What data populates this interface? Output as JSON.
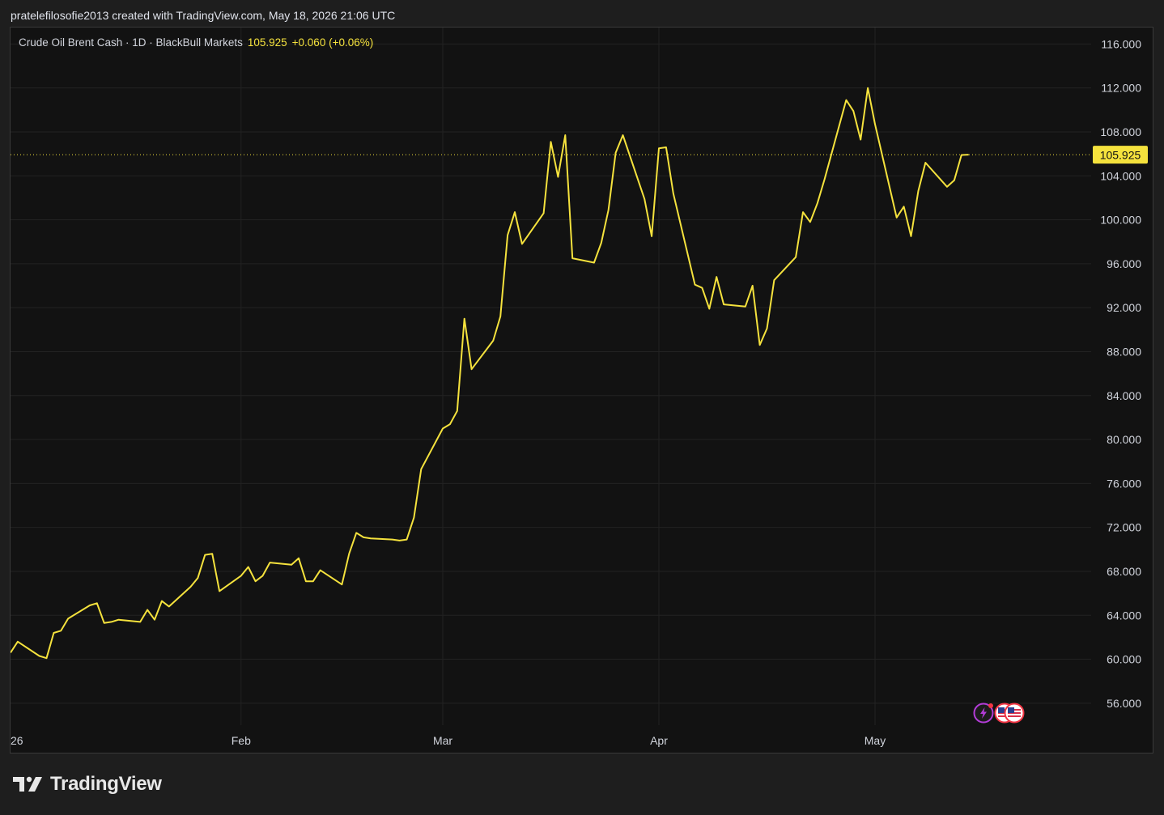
{
  "header": {
    "attribution": "pratelefilosofie2013 created with TradingView.com, May 18, 2026 21:06 UTC"
  },
  "legend": {
    "symbol": "Crude Oil Brent Cash · 1D · BlackBull Markets",
    "last_price": "105.925",
    "change": "+0.060 (+0.06%)"
  },
  "footer": {
    "brand": "TradingView"
  },
  "colors": {
    "line": "#f5e23d",
    "background": "#121212",
    "grid": "#222222",
    "axis_text": "#d1d4dc",
    "price_tag_bg": "#f5e23d",
    "price_tag_text": "#121212"
  },
  "chart_data": {
    "type": "line",
    "title": "",
    "xlabel": "",
    "ylabel": "",
    "ylim": [
      54.0,
      117.5
    ],
    "yticks": [
      56,
      60,
      64,
      68,
      72,
      76,
      80,
      84,
      88,
      92,
      96,
      100,
      104,
      108,
      112,
      116
    ],
    "ytick_labels": [
      "56.000",
      "60.000",
      "64.000",
      "68.000",
      "72.000",
      "76.000",
      "80.000",
      "84.000",
      "88.000",
      "92.000",
      "96.000",
      "100.000",
      "104.000",
      "108.000",
      "112.000",
      "116.000"
    ],
    "xlim": [
      "2026-01-01",
      "2026-05-31"
    ],
    "xticks": [
      {
        "label": "26",
        "date": "2026-01-01"
      },
      {
        "label": "Feb",
        "date": "2026-02-02"
      },
      {
        "label": "Mar",
        "date": "2026-03-02"
      },
      {
        "label": "Apr",
        "date": "2026-04-01"
      },
      {
        "label": "May",
        "date": "2026-05-01"
      }
    ],
    "grid": true,
    "last_value": 105.925,
    "series": [
      {
        "points": [
          [
            "2026-01-01",
            60.6
          ],
          [
            "2026-01-02",
            61.6
          ],
          [
            "2026-01-05",
            60.3
          ],
          [
            "2026-01-06",
            60.1
          ],
          [
            "2026-01-07",
            62.4
          ],
          [
            "2026-01-08",
            62.6
          ],
          [
            "2026-01-09",
            63.7
          ],
          [
            "2026-01-12",
            64.9
          ],
          [
            "2026-01-13",
            65.1
          ],
          [
            "2026-01-14",
            63.3
          ],
          [
            "2026-01-15",
            63.4
          ],
          [
            "2026-01-16",
            63.6
          ],
          [
            "2026-01-19",
            63.4
          ],
          [
            "2026-01-20",
            64.5
          ],
          [
            "2026-01-21",
            63.6
          ],
          [
            "2026-01-22",
            65.3
          ],
          [
            "2026-01-23",
            64.8
          ],
          [
            "2026-01-26",
            66.6
          ],
          [
            "2026-01-27",
            67.4
          ],
          [
            "2026-01-28",
            69.5
          ],
          [
            "2026-01-29",
            69.6
          ],
          [
            "2026-01-30",
            66.2
          ],
          [
            "2026-02-02",
            67.6
          ],
          [
            "2026-02-03",
            68.4
          ],
          [
            "2026-02-04",
            67.1
          ],
          [
            "2026-02-05",
            67.6
          ],
          [
            "2026-02-06",
            68.8
          ],
          [
            "2026-02-09",
            68.6
          ],
          [
            "2026-02-10",
            69.2
          ],
          [
            "2026-02-11",
            67.1
          ],
          [
            "2026-02-12",
            67.1
          ],
          [
            "2026-02-13",
            68.1
          ],
          [
            "2026-02-16",
            66.8
          ],
          [
            "2026-02-17",
            69.6
          ],
          [
            "2026-02-18",
            71.5
          ],
          [
            "2026-02-19",
            71.1
          ],
          [
            "2026-02-20",
            71.0
          ],
          [
            "2026-02-23",
            70.9
          ],
          [
            "2026-02-24",
            70.8
          ],
          [
            "2026-02-25",
            70.9
          ],
          [
            "2026-02-26",
            72.9
          ],
          [
            "2026-02-27",
            77.3
          ],
          [
            "2026-03-02",
            81.0
          ],
          [
            "2026-03-03",
            81.4
          ],
          [
            "2026-03-04",
            82.6
          ],
          [
            "2026-03-05",
            91.0
          ],
          [
            "2026-03-06",
            86.4
          ],
          [
            "2026-03-09",
            89.0
          ],
          [
            "2026-03-10",
            91.2
          ],
          [
            "2026-03-11",
            98.6
          ],
          [
            "2026-03-12",
            100.7
          ],
          [
            "2026-03-13",
            97.8
          ],
          [
            "2026-03-16",
            100.6
          ],
          [
            "2026-03-17",
            107.1
          ],
          [
            "2026-03-18",
            103.9
          ],
          [
            "2026-03-19",
            107.7
          ],
          [
            "2026-03-20",
            96.5
          ],
          [
            "2026-03-23",
            96.1
          ],
          [
            "2026-03-24",
            97.9
          ],
          [
            "2026-03-25",
            100.9
          ],
          [
            "2026-03-26",
            106.1
          ],
          [
            "2026-03-27",
            107.7
          ],
          [
            "2026-03-30",
            101.9
          ],
          [
            "2026-03-31",
            98.5
          ],
          [
            "2026-04-01",
            106.5
          ],
          [
            "2026-04-02",
            106.6
          ],
          [
            "2026-04-03",
            102.4
          ],
          [
            "2026-04-06",
            94.1
          ],
          [
            "2026-04-07",
            93.8
          ],
          [
            "2026-04-08",
            91.9
          ],
          [
            "2026-04-09",
            94.8
          ],
          [
            "2026-04-10",
            92.3
          ],
          [
            "2026-04-13",
            92.1
          ],
          [
            "2026-04-14",
            94.0
          ],
          [
            "2026-04-15",
            88.6
          ],
          [
            "2026-04-16",
            90.1
          ],
          [
            "2026-04-17",
            94.5
          ],
          [
            "2026-04-20",
            96.6
          ],
          [
            "2026-04-21",
            100.7
          ],
          [
            "2026-04-22",
            99.8
          ],
          [
            "2026-04-23",
            101.5
          ],
          [
            "2026-04-24",
            103.7
          ],
          [
            "2026-04-27",
            110.9
          ],
          [
            "2026-04-28",
            109.9
          ],
          [
            "2026-04-29",
            107.3
          ],
          [
            "2026-04-30",
            112.0
          ],
          [
            "2026-05-01",
            108.7
          ],
          [
            "2026-05-04",
            100.2
          ],
          [
            "2026-05-05",
            101.2
          ],
          [
            "2026-05-06",
            98.5
          ],
          [
            "2026-05-07",
            102.6
          ],
          [
            "2026-05-08",
            105.2
          ],
          [
            "2026-05-11",
            103.0
          ],
          [
            "2026-05-12",
            103.6
          ],
          [
            "2026-05-13",
            105.9
          ],
          [
            "2026-05-14",
            105.925
          ]
        ]
      }
    ]
  }
}
